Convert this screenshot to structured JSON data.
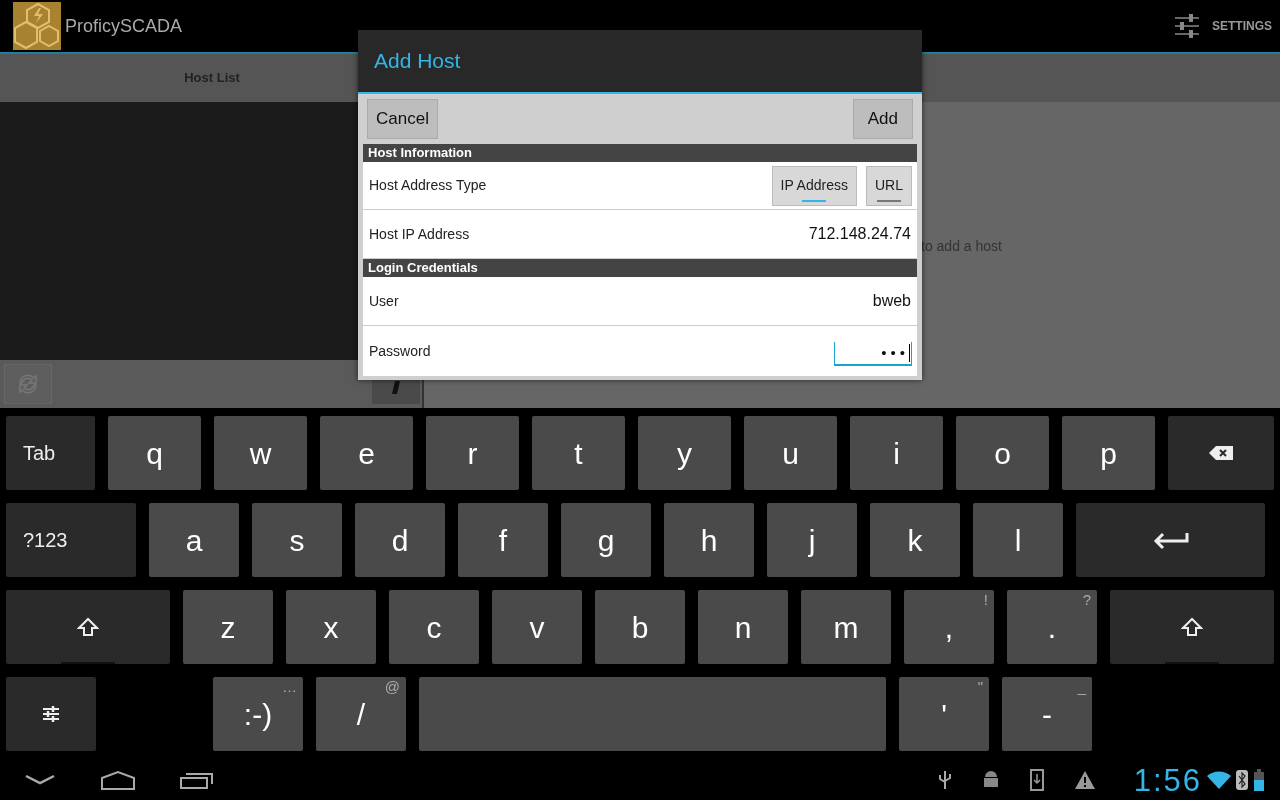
{
  "app_bar": {
    "title": "ProficySCADA",
    "settings_label": "SETTINGS"
  },
  "host_list": {
    "tab_label": "Host List",
    "empty_message": "to add a host"
  },
  "dialog": {
    "title": "Add Host",
    "cancel": "Cancel",
    "add": "Add",
    "sections": [
      {
        "title": "Host Information",
        "rows": [
          {
            "kind": "toggle",
            "label": "Host Address Type",
            "options": [
              {
                "label": "IP Address",
                "selected": true
              },
              {
                "label": "URL",
                "selected": false
              }
            ]
          },
          {
            "kind": "value",
            "label": "Host IP Address",
            "value": "712.148.24.74"
          }
        ]
      },
      {
        "title": "Login Credentials",
        "rows": [
          {
            "kind": "value",
            "label": "User",
            "value": "bweb"
          },
          {
            "kind": "password",
            "label": "Password",
            "value": "•••"
          }
        ]
      }
    ]
  },
  "keyboard": [
    [
      {
        "kind": "tab",
        "label": "Tab"
      },
      {
        "kind": "letter",
        "label": "q"
      },
      {
        "kind": "letter",
        "label": "w"
      },
      {
        "kind": "letter",
        "label": "e"
      },
      {
        "kind": "letter",
        "label": "r"
      },
      {
        "kind": "letter",
        "label": "t"
      },
      {
        "kind": "letter",
        "label": "y"
      },
      {
        "kind": "letter",
        "label": "u"
      },
      {
        "kind": "letter",
        "label": "i"
      },
      {
        "kind": "letter",
        "label": "o"
      },
      {
        "kind": "letter",
        "label": "p"
      },
      {
        "kind": "backspace"
      }
    ],
    [
      {
        "kind": "symbols",
        "label": "?123"
      },
      {
        "kind": "letter",
        "label": "a"
      },
      {
        "kind": "letter",
        "label": "s"
      },
      {
        "kind": "letter",
        "label": "d"
      },
      {
        "kind": "letter",
        "label": "f"
      },
      {
        "kind": "letter",
        "label": "g"
      },
      {
        "kind": "letter",
        "label": "h"
      },
      {
        "kind": "letter",
        "label": "j"
      },
      {
        "kind": "letter",
        "label": "k"
      },
      {
        "kind": "letter",
        "label": "l"
      },
      {
        "kind": "enter"
      }
    ],
    [
      {
        "kind": "shift"
      },
      {
        "kind": "letter",
        "label": "z"
      },
      {
        "kind": "letter",
        "label": "x"
      },
      {
        "kind": "letter",
        "label": "c"
      },
      {
        "kind": "letter",
        "label": "v"
      },
      {
        "kind": "letter",
        "label": "b"
      },
      {
        "kind": "letter",
        "label": "n"
      },
      {
        "kind": "letter",
        "label": "m"
      },
      {
        "kind": "letter",
        "label": ",",
        "hint": "!"
      },
      {
        "kind": "letter",
        "label": ".",
        "hint": "?"
      },
      {
        "kind": "shift"
      }
    ],
    [
      {
        "kind": "settings"
      },
      {
        "kind": "gap"
      },
      {
        "kind": "letter",
        "label": ":-)",
        "hint": "…"
      },
      {
        "kind": "letter",
        "label": "/",
        "hint": "@"
      },
      {
        "kind": "space"
      },
      {
        "kind": "letter",
        "label": "'",
        "hint": "\""
      },
      {
        "kind": "letter",
        "label": "-",
        "hint": "_"
      }
    ]
  ],
  "status_bar": {
    "time": "1:56"
  }
}
